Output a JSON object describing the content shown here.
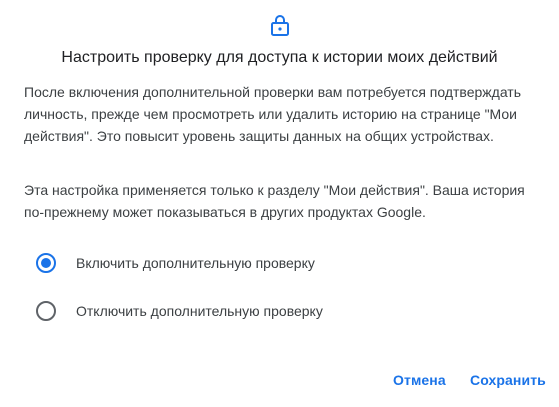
{
  "dialog": {
    "title": "Настроить проверку для доступа к истории моих действий",
    "icon": "lock-icon",
    "paragraph1": "После включения дополнительной проверки вам потребуется подтверждать личность, прежде чем просмотреть или удалить историю на странице \"Мои действия\". Это повысит уровень защиты данных на общих устройствах.",
    "paragraph2": "Эта настройка применяется только к разделу \"Мои действия\". Ваша история по-прежнему может показываться в других продуктах Google.",
    "options": [
      {
        "label": "Включить дополнительную проверку",
        "selected": true
      },
      {
        "label": "Отключить дополнительную проверку",
        "selected": false
      }
    ],
    "cancel_label": "Отмена",
    "save_label": "Сохранить",
    "accent_color": "#1a73e8"
  }
}
